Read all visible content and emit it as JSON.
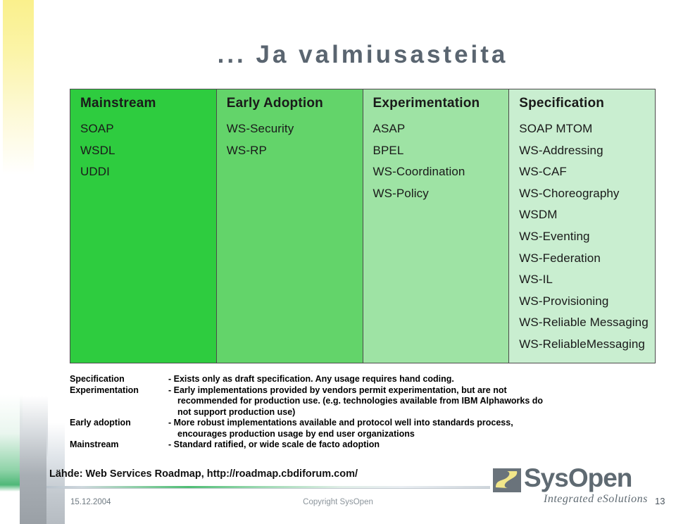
{
  "slide": {
    "title": "... Ja valmiusasteita"
  },
  "matrix": {
    "columns": [
      {
        "header": "Mainstream",
        "color": "#2ecc3f",
        "items": [
          "SOAP",
          "WSDL",
          "UDDI"
        ]
      },
      {
        "header": "Early Adoption",
        "color": "#63d46a",
        "items": [
          "WS-Security",
          "WS-RP"
        ]
      },
      {
        "header": "Experimentation",
        "color": "#9ee3a4",
        "items": [
          "ASAP",
          "BPEL",
          "WS-Coordination",
          "WS-Policy"
        ]
      },
      {
        "header": "Specification",
        "color": "#c9eed0",
        "items": [
          "SOAP MTOM",
          "WS-Addressing",
          "WS-CAF",
          "WS-Choreography",
          "WSDM",
          "WS-Eventing",
          "WS-Federation",
          "WS-IL",
          "WS-Provisioning",
          "WS-Reliable Messaging",
          "WS-ReliableMessaging"
        ]
      }
    ]
  },
  "legend": {
    "rows": [
      {
        "term": "Specification",
        "desc": "- Exists only as draft specification. Any usage requires hand coding.",
        "cont": []
      },
      {
        "term": "Experimentation",
        "desc": "- Early implementations provided by vendors permit experimentation, but are not",
        "cont": [
          "recommended for production use. (e.g. technologies available from IBM Alphaworks do",
          "not support production use)"
        ]
      },
      {
        "term": "Early adoption",
        "desc": "- More robust implementations available and protocol well into standards process,",
        "cont": [
          "encourages production usage by end user organizations"
        ]
      },
      {
        "term": "Mainstream",
        "desc": "- Standard ratified, or wide scale de facto adoption",
        "cont": []
      }
    ]
  },
  "source": {
    "text": "Lähde: Web Services Roadmap, http://roadmap.cbdiforum.com/"
  },
  "footer": {
    "date": "15.12.2004",
    "copyright": "Copyright SysOpen",
    "page": "13"
  },
  "logo": {
    "word": "SysOpen",
    "tagline": "Integrated eSolutions",
    "mark_gray": "#6a737b",
    "mark_yellow": "#f2e68a"
  }
}
